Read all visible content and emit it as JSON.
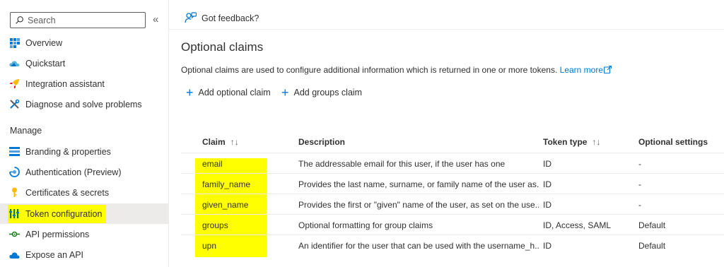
{
  "sidebar": {
    "search_placeholder": "Search",
    "collapse_glyph": "«",
    "items_top": [
      {
        "label": "Overview",
        "icon": "overview-icon"
      },
      {
        "label": "Quickstart",
        "icon": "quickstart-cloud-icon"
      },
      {
        "label": "Integration assistant",
        "icon": "rocket-icon"
      },
      {
        "label": "Diagnose and solve problems",
        "icon": "wrench-icon"
      }
    ],
    "section_label": "Manage",
    "items_manage": [
      {
        "label": "Branding & properties",
        "icon": "branding-icon"
      },
      {
        "label": "Authentication (Preview)",
        "icon": "authentication-icon"
      },
      {
        "label": "Certificates & secrets",
        "icon": "key-icon"
      },
      {
        "label": "Token configuration",
        "icon": "token-bars-icon"
      },
      {
        "label": "API permissions",
        "icon": "api-permissions-icon"
      },
      {
        "label": "Expose an API",
        "icon": "cloud-api-icon"
      }
    ]
  },
  "topbar": {
    "feedback_label": "Got feedback?"
  },
  "main": {
    "title": "Optional claims",
    "description": "Optional claims are used to configure additional information which is returned in one or more tokens.",
    "learn_more": "Learn more",
    "add_optional_claim": "Add optional claim",
    "add_groups_claim": "Add groups claim"
  },
  "table": {
    "headers": {
      "claim": "Claim",
      "description": "Description",
      "token_type": "Token type",
      "optional_settings": "Optional settings",
      "sort_glyph": "↑↓"
    },
    "rows": [
      {
        "claim": "email",
        "description": "The addressable email for this user, if the user has one",
        "token_type": "ID",
        "optional_settings": "-"
      },
      {
        "claim": "family_name",
        "description": "Provides the last name, surname, or family name of the user as...",
        "token_type": "ID",
        "optional_settings": "-"
      },
      {
        "claim": "given_name",
        "description": "Provides the first or \"given\" name of the user, as set on the use...",
        "token_type": "ID",
        "optional_settings": "-"
      },
      {
        "claim": "groups",
        "description": "Optional formatting for group claims",
        "token_type": "ID, Access, SAML",
        "optional_settings": "Default"
      },
      {
        "claim": "upn",
        "description": "An identifier for the user that can be used with the username_h...",
        "token_type": "ID",
        "optional_settings": "Default"
      }
    ]
  },
  "colors": {
    "accent": "#0078d4",
    "highlight": "#ffff00",
    "active_bg": "#edebe9"
  }
}
